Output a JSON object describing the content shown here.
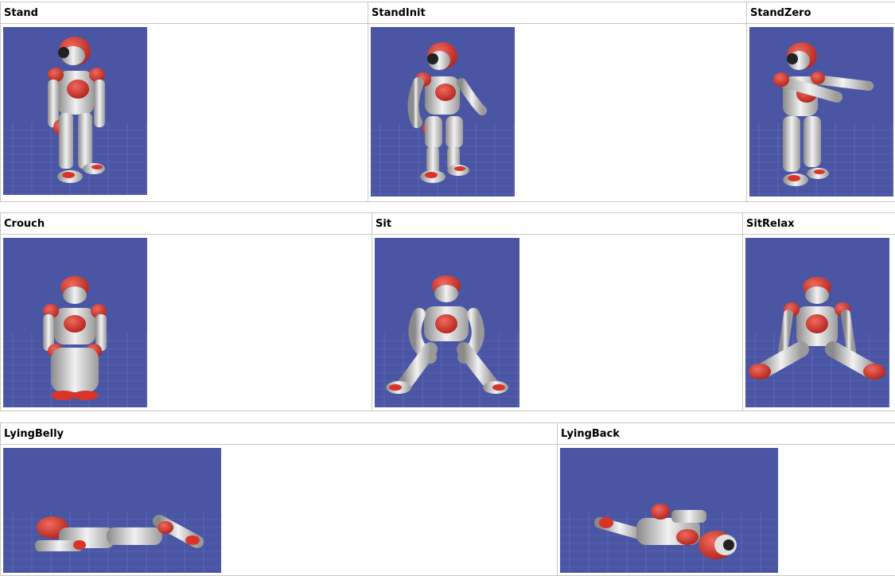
{
  "rows": [
    {
      "poses": [
        {
          "label": "Stand",
          "image": "nao-robot-standing-render"
        },
        {
          "label": "StandInit",
          "image": "nao-robot-standinit-render"
        },
        {
          "label": "StandZero",
          "image": "nao-robot-standzero-arms-forward-render"
        }
      ]
    },
    {
      "poses": [
        {
          "label": "Crouch",
          "image": "nao-robot-crouching-render"
        },
        {
          "label": "Sit",
          "image": "nao-robot-sitting-render"
        },
        {
          "label": "SitRelax",
          "image": "nao-robot-sitting-relaxed-render"
        }
      ]
    },
    {
      "poses": [
        {
          "label": "LyingBelly",
          "image": "nao-robot-lying-on-belly-render"
        },
        {
          "label": "LyingBack",
          "image": "nao-robot-lying-on-back-render"
        }
      ]
    }
  ],
  "colors": {
    "render_background": "#4a56a4",
    "robot_red": "#d8342a",
    "robot_white": "#e9e9e9",
    "border": "#c8c8c8"
  }
}
